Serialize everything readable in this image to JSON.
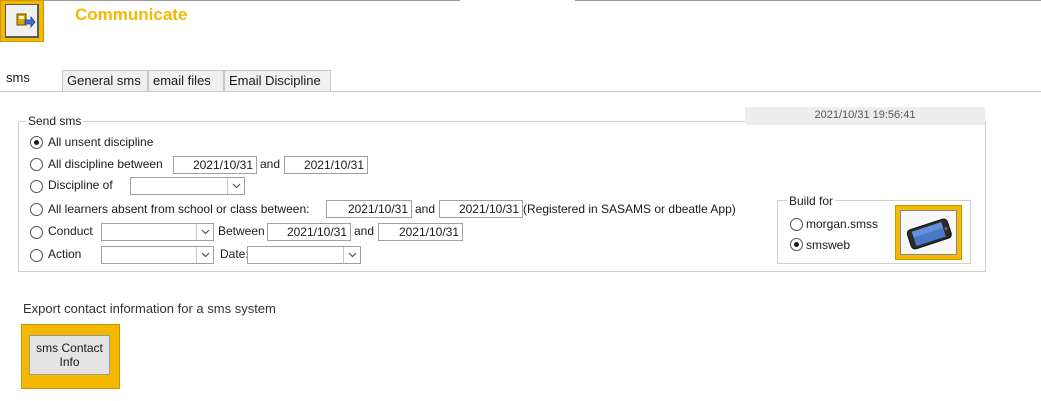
{
  "header": {
    "title": "Communicate"
  },
  "tabs": [
    {
      "label": "sms",
      "active": true
    },
    {
      "label": "General sms"
    },
    {
      "label": "email files"
    },
    {
      "label": "Email Discipline"
    }
  ],
  "send_sms": {
    "group_label": "Send sms",
    "timestamp": "2021/10/31 19:56:41",
    "selected_option": "All unsent discipline",
    "options": {
      "unsent": {
        "label": "All unsent discipline"
      },
      "between": {
        "label": "All discipline between",
        "from": "2021/10/31",
        "and_label": "and",
        "to": "2021/10/31"
      },
      "discipline_of": {
        "label": "Discipline of",
        "value": ""
      },
      "absent": {
        "label": "All learners absent from school or class between:",
        "from": "2021/10/31",
        "and_label": "and",
        "to": "2021/10/31",
        "note": "(Registered in SASAMS or dbeatle App)"
      },
      "conduct": {
        "label": "Conduct",
        "value": "",
        "between_label": "Between",
        "from": "2021/10/31",
        "and_label": "and",
        "to": "2021/10/31"
      },
      "action": {
        "label": "Action",
        "value": "",
        "date_label": "Date:",
        "date_value": ""
      }
    }
  },
  "build_for": {
    "label": "Build for",
    "selected": "smsweb",
    "options": [
      "morgan.smss",
      "smsweb"
    ]
  },
  "export": {
    "label": "Export contact information for a sms system",
    "button_line1": "sms Contact",
    "button_line2": "Info"
  },
  "colors": {
    "accent": "#f5b800",
    "title": "#f5b800"
  },
  "icons": {
    "app": "communicate-icon",
    "phone": "mobile-phone-icon",
    "dropdown": "chevron-down-icon"
  }
}
